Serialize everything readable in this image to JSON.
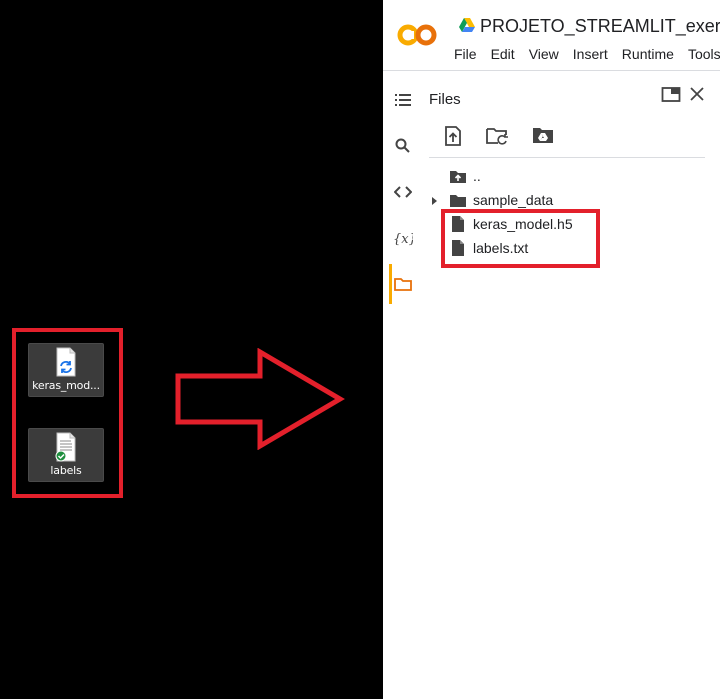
{
  "desktop": {
    "icons": [
      {
        "label": "keras_mod...",
        "icon": "keras-file-sync-icon"
      },
      {
        "label": "labels",
        "icon": "text-file-check-icon"
      }
    ]
  },
  "colab": {
    "logo_text": "CO",
    "title": "PROJETO_STREAMLIT_exercicio",
    "menu": [
      "File",
      "Edit",
      "View",
      "Insert",
      "Runtime",
      "Tools"
    ],
    "files_panel": {
      "title": "Files",
      "tree": [
        {
          "label": "..",
          "icon": "folder-up-icon"
        },
        {
          "label": "sample_data",
          "icon": "folder-icon"
        },
        {
          "label": "keras_model.h5",
          "icon": "file-icon"
        },
        {
          "label": "labels.txt",
          "icon": "file-icon"
        }
      ]
    },
    "sidebar": [
      "table-of-contents-icon",
      "search-icon",
      "code-snippets-icon",
      "variables-icon",
      "files-icon"
    ]
  },
  "colors": {
    "highlight": "#e3202b",
    "colab_orange": "#f9ab00"
  }
}
